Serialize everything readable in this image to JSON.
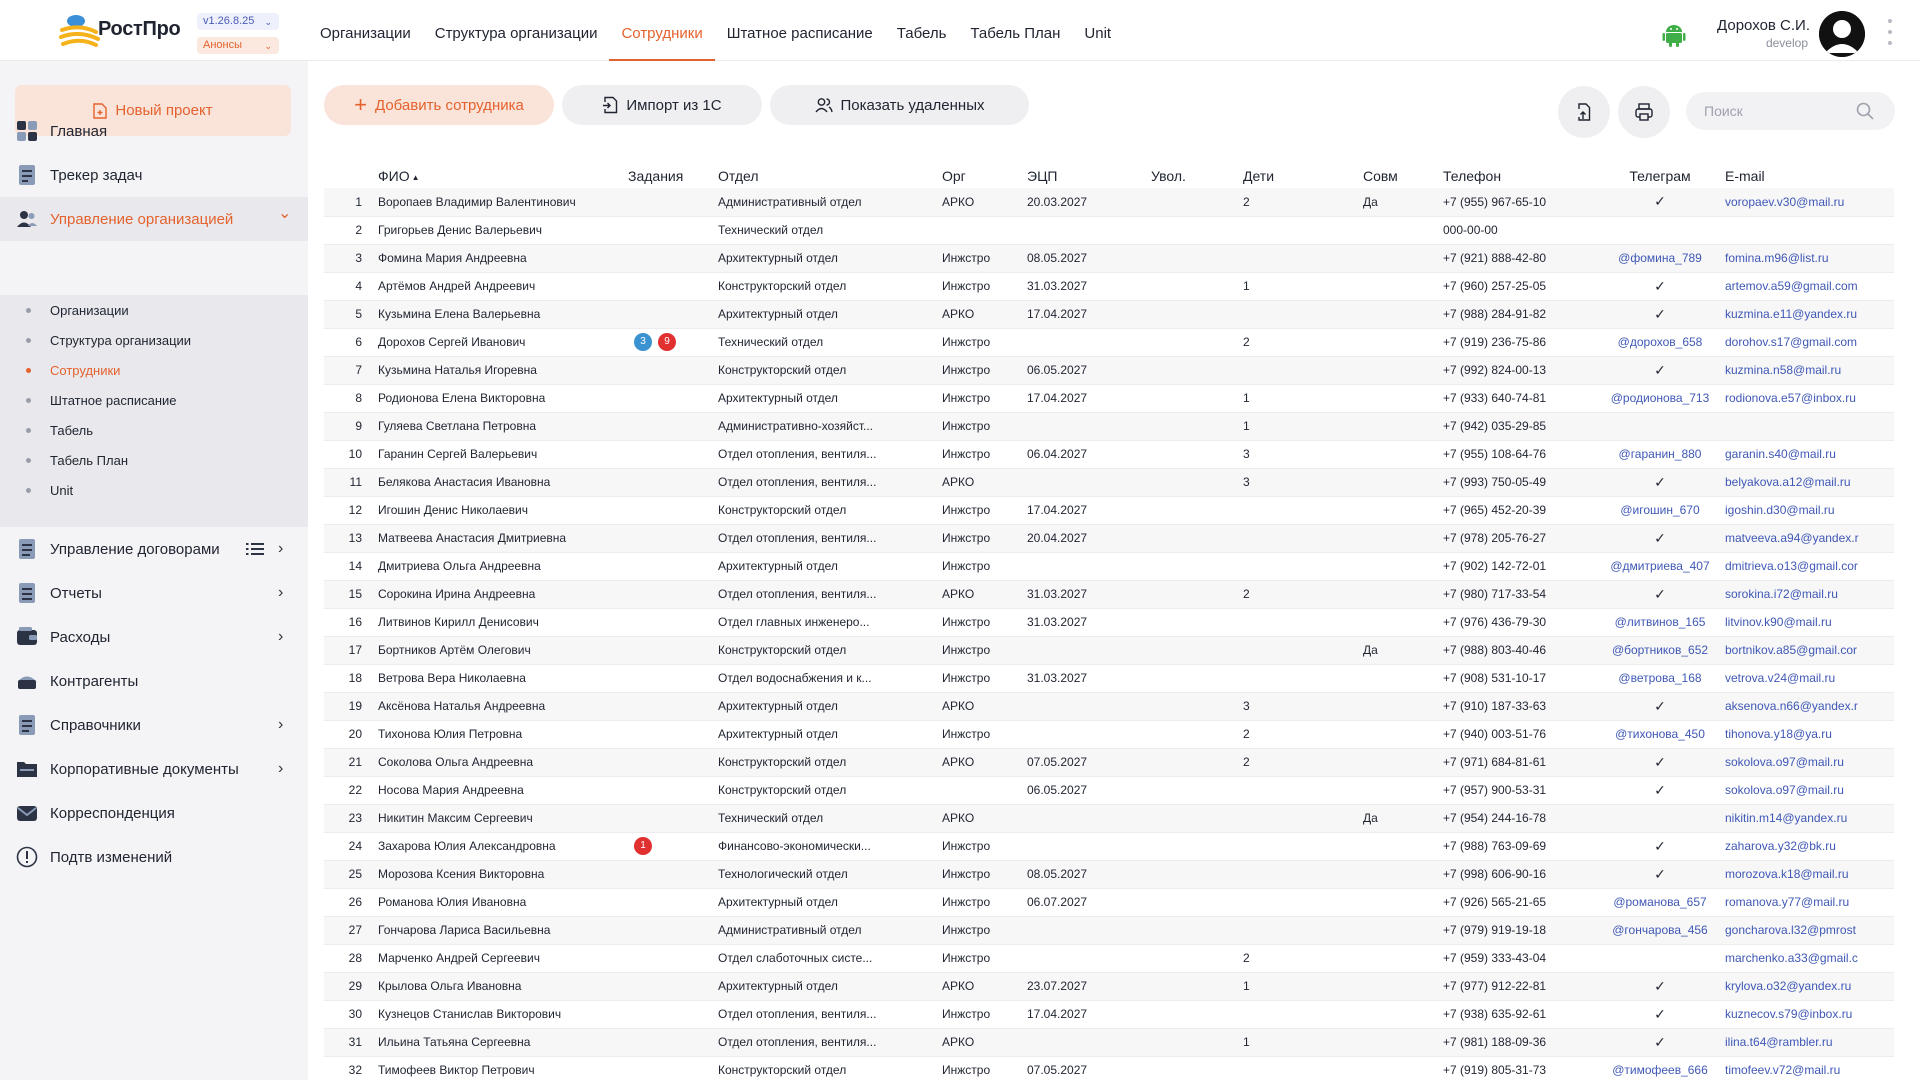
{
  "app": {
    "brand": "РостПро",
    "version": "v1.26.8.25",
    "announcements": "Анонсы"
  },
  "topnav": [
    {
      "label": "Организации",
      "active": false
    },
    {
      "label": "Структура организации",
      "active": false
    },
    {
      "label": "Сотрудники",
      "active": true
    },
    {
      "label": "Штатное расписание",
      "active": false
    },
    {
      "label": "Табель",
      "active": false
    },
    {
      "label": "Табель План",
      "active": false
    },
    {
      "label": "Unit",
      "active": false
    }
  ],
  "user": {
    "name": "Дорохов С.И.",
    "role": "develop"
  },
  "sidebar": {
    "new_project": "Новый проект",
    "items": [
      {
        "label": "Главная",
        "icon": "dashboard-icon"
      },
      {
        "label": "Трекер задач",
        "icon": "task-tracker-icon"
      },
      {
        "label": "Управление организацией",
        "icon": "people-icon",
        "expanded": true
      },
      {
        "label": "Управление договорами",
        "icon": "contracts-icon",
        "chevron": true
      },
      {
        "label": "Отчеты",
        "icon": "reports-icon",
        "chevron": true
      },
      {
        "label": "Расходы",
        "icon": "wallet-icon",
        "chevron": true
      },
      {
        "label": "Контрагенты",
        "icon": "contractors-icon"
      },
      {
        "label": "Справочники",
        "icon": "reference-icon",
        "chevron": true
      },
      {
        "label": "Корпоративные документы",
        "icon": "folder-icon",
        "chevron": true
      },
      {
        "label": "Корреспонденция",
        "icon": "mail-icon"
      },
      {
        "label": "Подтв изменений",
        "icon": "info-icon"
      }
    ],
    "subitems": [
      {
        "label": "Организации",
        "active": false
      },
      {
        "label": "Структура организации",
        "active": false
      },
      {
        "label": "Сотрудники",
        "active": true
      },
      {
        "label": "Штатное расписание",
        "active": false
      },
      {
        "label": "Табель",
        "active": false
      },
      {
        "label": "Табель План",
        "active": false
      },
      {
        "label": "Unit",
        "active": false
      }
    ]
  },
  "toolbar": {
    "add_employee": "Добавить сотрудника",
    "import_1c": "Импорт из 1С",
    "show_deleted": "Показать удаленных",
    "search_placeholder": "Поиск"
  },
  "colors": {
    "accent": "#e4622e",
    "link": "#3f58b5",
    "badge_blue": "#3a93d0",
    "badge_red": "#e0302f"
  },
  "table": {
    "columns": [
      "",
      "ФИО",
      "Задания",
      "Отдел",
      "Орг",
      "ЭЦП",
      "Увол.",
      "Дети",
      "Совм",
      "Телефон",
      "Телеграм",
      "E-mail"
    ],
    "sorted_by": "ФИО",
    "rows": [
      {
        "n": "1",
        "fio": "Воропаев Владимир Валентинович",
        "badges": [],
        "dept": "Административный отдел",
        "org": "АРКО",
        "ecp": "20.03.2027",
        "fired": "",
        "kids": "2",
        "sovm": "Да",
        "phone": "+7 (955) 967-65-10",
        "tg": "✓",
        "email": "voropaev.v30@mail.ru"
      },
      {
        "n": "2",
        "fio": "Григорьев Денис Валерьевич",
        "badges": [],
        "dept": "Технический отдел",
        "org": "",
        "ecp": "",
        "fired": "",
        "kids": "",
        "sovm": "",
        "phone": "000-00-00",
        "tg": "",
        "email": ""
      },
      {
        "n": "3",
        "fio": "Фомина Мария Андреевна",
        "badges": [],
        "dept": "Архитектурный отдел",
        "org": "Инжстро",
        "ecp": "08.05.2027",
        "fired": "",
        "kids": "",
        "sovm": "",
        "phone": "+7 (921) 888-42-80",
        "tg": "@фомина_789",
        "email": "fomina.m96@list.ru"
      },
      {
        "n": "4",
        "fio": "Артёмов Андрей Андреевич",
        "badges": [],
        "dept": "Конструкторский отдел",
        "org": "Инжстро",
        "ecp": "31.03.2027",
        "fired": "",
        "kids": "1",
        "sovm": "",
        "phone": "+7 (960) 257-25-05",
        "tg": "✓",
        "email": "artemov.a59@gmail.com"
      },
      {
        "n": "5",
        "fio": "Кузьмина Елена Валерьевна",
        "badges": [],
        "dept": "Архитектурный отдел",
        "org": "АРКО",
        "ecp": "17.04.2027",
        "fired": "",
        "kids": "",
        "sovm": "",
        "phone": "+7 (988) 284-91-82",
        "tg": "✓",
        "email": "kuzmina.e11@yandex.ru"
      },
      {
        "n": "6",
        "fio": "Дорохов Сергей Иванович",
        "badges": [
          {
            "v": "3",
            "c": "blue"
          },
          {
            "v": "9",
            "c": "red"
          }
        ],
        "dept": "Технический отдел",
        "org": "Инжстро",
        "ecp": "",
        "fired": "",
        "kids": "2",
        "sovm": "",
        "phone": "+7 (919) 236-75-86",
        "tg": "@дорохов_658",
        "email": "dorohov.s17@gmail.com"
      },
      {
        "n": "7",
        "fio": "Кузьмина Наталья Игоревна",
        "badges": [],
        "dept": "Конструкторский отдел",
        "org": "Инжстро",
        "ecp": "06.05.2027",
        "fired": "",
        "kids": "",
        "sovm": "",
        "phone": "+7 (992) 824-00-13",
        "tg": "✓",
        "email": "kuzmina.n58@mail.ru"
      },
      {
        "n": "8",
        "fio": "Родионова Елена Викторовна",
        "badges": [],
        "dept": "Архитектурный отдел",
        "org": "Инжстро",
        "ecp": "17.04.2027",
        "fired": "",
        "kids": "1",
        "sovm": "",
        "phone": "+7 (933) 640-74-81",
        "tg": "@родионова_713",
        "email": "rodionova.e57@inbox.ru"
      },
      {
        "n": "9",
        "fio": "Гуляева Светлана Петровна",
        "badges": [],
        "dept": "Административно-хозяйст...",
        "org": "Инжстро",
        "ecp": "",
        "fired": "",
        "kids": "1",
        "sovm": "",
        "phone": "+7 (942) 035-29-85",
        "tg": "",
        "email": ""
      },
      {
        "n": "10",
        "fio": "Гаранин Сергей Валерьевич",
        "badges": [],
        "dept": "Отдел отопления, вентиля...",
        "org": "Инжстро",
        "ecp": "06.04.2027",
        "fired": "",
        "kids": "3",
        "sovm": "",
        "phone": "+7 (955) 108-64-76",
        "tg": "@гаранин_880",
        "email": "garanin.s40@mail.ru"
      },
      {
        "n": "11",
        "fio": "Белякова Анастасия Ивановна",
        "badges": [],
        "dept": "Отдел отопления, вентиля...",
        "org": "АРКО",
        "ecp": "",
        "fired": "",
        "kids": "3",
        "sovm": "",
        "phone": "+7 (993) 750-05-49",
        "tg": "✓",
        "email": "belyakova.a12@mail.ru"
      },
      {
        "n": "12",
        "fio": "Игошин Денис Николаевич",
        "badges": [],
        "dept": "Конструкторский отдел",
        "org": "Инжстро",
        "ecp": "17.04.2027",
        "fired": "",
        "kids": "",
        "sovm": "",
        "phone": "+7 (965) 452-20-39",
        "tg": "@игошин_670",
        "email": "igoshin.d30@mail.ru"
      },
      {
        "n": "13",
        "fio": "Матвеева Анастасия Дмитриевна",
        "badges": [],
        "dept": "Отдел отопления, вентиля...",
        "org": "Инжстро",
        "ecp": "20.04.2027",
        "fired": "",
        "kids": "",
        "sovm": "",
        "phone": "+7 (978) 205-76-27",
        "tg": "✓",
        "email": "matveeva.a94@yandex.r"
      },
      {
        "n": "14",
        "fio": "Дмитриева Ольга Андреевна",
        "badges": [],
        "dept": "Архитектурный отдел",
        "org": "Инжстро",
        "ecp": "",
        "fired": "",
        "kids": "",
        "sovm": "",
        "phone": "+7 (902) 142-72-01",
        "tg": "@дмитриева_407",
        "email": "dmitrieva.o13@gmail.cor"
      },
      {
        "n": "15",
        "fio": "Сорокина Ирина Андреевна",
        "badges": [],
        "dept": "Отдел отопления, вентиля...",
        "org": "АРКО",
        "ecp": "31.03.2027",
        "fired": "",
        "kids": "2",
        "sovm": "",
        "phone": "+7 (980) 717-33-54",
        "tg": "✓",
        "email": "sorokina.i72@mail.ru"
      },
      {
        "n": "16",
        "fio": "Литвинов Кирилл Денисович",
        "badges": [],
        "dept": "Отдел главных инженеро...",
        "org": "Инжстро",
        "ecp": "31.03.2027",
        "fired": "",
        "kids": "",
        "sovm": "",
        "phone": "+7 (976) 436-79-30",
        "tg": "@литвинов_165",
        "email": "litvinov.k90@mail.ru"
      },
      {
        "n": "17",
        "fio": "Бортников Артём Олегович",
        "badges": [],
        "dept": "Конструкторский отдел",
        "org": "Инжстро",
        "ecp": "",
        "fired": "",
        "kids": "",
        "sovm": "Да",
        "phone": "+7 (988) 803-40-46",
        "tg": "@бортников_652",
        "email": "bortnikov.a85@gmail.cor"
      },
      {
        "n": "18",
        "fio": "Ветрова Вера Николаевна",
        "badges": [],
        "dept": "Отдел водоснабжения и к...",
        "org": "Инжстро",
        "ecp": "31.03.2027",
        "fired": "",
        "kids": "",
        "sovm": "",
        "phone": "+7 (908) 531-10-17",
        "tg": "@ветрова_168",
        "email": "vetrova.v24@mail.ru"
      },
      {
        "n": "19",
        "fio": "Аксёнова Наталья Андреевна",
        "badges": [],
        "dept": "Архитектурный отдел",
        "org": "АРКО",
        "ecp": "",
        "fired": "",
        "kids": "3",
        "sovm": "",
        "phone": "+7 (910) 187-33-63",
        "tg": "✓",
        "email": "aksenova.n66@yandex.r"
      },
      {
        "n": "20",
        "fio": "Тихонова Юлия Петровна",
        "badges": [],
        "dept": "Архитектурный отдел",
        "org": "Инжстро",
        "ecp": "",
        "fired": "",
        "kids": "2",
        "sovm": "",
        "phone": "+7 (940) 003-51-76",
        "tg": "@тихонова_450",
        "email": "tihonova.y18@ya.ru"
      },
      {
        "n": "21",
        "fio": "Соколова Ольга Андреевна",
        "badges": [],
        "dept": "Конструкторский отдел",
        "org": "АРКО",
        "ecp": "07.05.2027",
        "fired": "",
        "kids": "2",
        "sovm": "",
        "phone": "+7 (971) 684-81-61",
        "tg": "✓",
        "email": "sokolova.o97@mail.ru"
      },
      {
        "n": "22",
        "fio": "Носова Мария Андреевна",
        "badges": [],
        "dept": "Конструкторский отдел",
        "org": "",
        "ecp": "06.05.2027",
        "fired": "",
        "kids": "",
        "sovm": "",
        "phone": "+7 (957) 900-53-31",
        "tg": "✓",
        "email": "sokolova.o97@mail.ru"
      },
      {
        "n": "23",
        "fio": "Никитин Максим Сергеевич",
        "badges": [],
        "dept": "Технический отдел",
        "org": "АРКО",
        "ecp": "",
        "fired": "",
        "kids": "",
        "sovm": "Да",
        "phone": "+7 (954) 244-16-78",
        "tg": "",
        "email": "nikitin.m14@yandex.ru"
      },
      {
        "n": "24",
        "fio": "Захарова Юлия Александровна",
        "badges": [
          {
            "v": "1",
            "c": "red"
          }
        ],
        "dept": "Финансово-экономически...",
        "org": "Инжстро",
        "ecp": "",
        "fired": "",
        "kids": "",
        "sovm": "",
        "phone": "+7 (988) 763-09-69",
        "tg": "✓",
        "email": "zaharova.y32@bk.ru"
      },
      {
        "n": "25",
        "fio": "Морозова Ксения Викторовна",
        "badges": [],
        "dept": "Технологический отдел",
        "org": "Инжстро",
        "ecp": "08.05.2027",
        "fired": "",
        "kids": "",
        "sovm": "",
        "phone": "+7 (998) 606-90-16",
        "tg": "✓",
        "email": "morozova.k18@mail.ru"
      },
      {
        "n": "26",
        "fio": "Романова Юлия Ивановна",
        "badges": [],
        "dept": "Архитектурный отдел",
        "org": "Инжстро",
        "ecp": "06.07.2027",
        "fired": "",
        "kids": "",
        "sovm": "",
        "phone": "+7 (926) 565-21-65",
        "tg": "@романова_657",
        "email": "romanova.y77@mail.ru"
      },
      {
        "n": "27",
        "fio": "Гончарова Лариса Васильевна",
        "badges": [],
        "dept": "Административный отдел",
        "org": "Инжстро",
        "ecp": "",
        "fired": "",
        "kids": "",
        "sovm": "",
        "phone": "+7 (979) 919-19-18",
        "tg": "@гончарова_456",
        "email": "goncharova.l32@pmrost"
      },
      {
        "n": "28",
        "fio": "Марченко Андрей Сергеевич",
        "badges": [],
        "dept": "Отдел слаботочных систе...",
        "org": "Инжстро",
        "ecp": "",
        "fired": "",
        "kids": "2",
        "sovm": "",
        "phone": "+7 (959) 333-43-04",
        "tg": "",
        "email": "marchenko.a33@gmail.c"
      },
      {
        "n": "29",
        "fio": "Крылова Ольга Ивановна",
        "badges": [],
        "dept": "Архитектурный отдел",
        "org": "АРКО",
        "ecp": "23.07.2027",
        "fired": "",
        "kids": "1",
        "sovm": "",
        "phone": "+7 (977) 912-22-81",
        "tg": "✓",
        "email": "krylova.o32@yandex.ru"
      },
      {
        "n": "30",
        "fio": "Кузнецов Станислав Викторович",
        "badges": [],
        "dept": "Отдел отопления, вентиля...",
        "org": "Инжстро",
        "ecp": "17.04.2027",
        "fired": "",
        "kids": "",
        "sovm": "",
        "phone": "+7 (938) 635-92-61",
        "tg": "✓",
        "email": "kuznecov.s79@inbox.ru"
      },
      {
        "n": "31",
        "fio": "Ильина Татьяна Сергеевна",
        "badges": [],
        "dept": "Отдел отопления, вентиля...",
        "org": "АРКО",
        "ecp": "",
        "fired": "",
        "kids": "1",
        "sovm": "",
        "phone": "+7 (981) 188-09-36",
        "tg": "✓",
        "email": "ilina.t64@rambler.ru"
      },
      {
        "n": "32",
        "fio": "Тимофеев Виктор Петрович",
        "badges": [],
        "dept": "Конструкторский отдел",
        "org": "Инжстро",
        "ecp": "07.05.2027",
        "fired": "",
        "kids": "",
        "sovm": "",
        "phone": "+7 (919) 805-31-73",
        "tg": "@тимофеев_666",
        "email": "timofeev.v72@mail.ru"
      }
    ]
  }
}
